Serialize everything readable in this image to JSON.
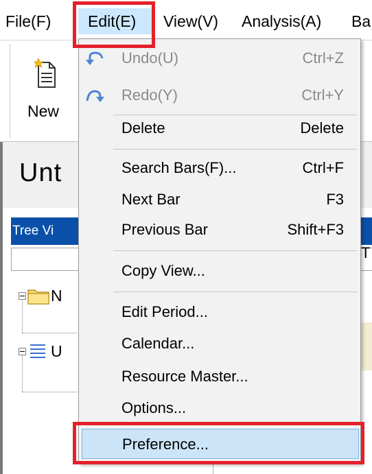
{
  "menubar": {
    "items": [
      {
        "label": "File(F)"
      },
      {
        "label": "Edit(E)"
      },
      {
        "label": "View(V)"
      },
      {
        "label": "Analysis(A)"
      },
      {
        "label": "Ba"
      }
    ]
  },
  "toolbar": {
    "new_label": "New",
    "new_icon": "new-document-icon"
  },
  "document": {
    "title": "Unt"
  },
  "tree": {
    "header": "Tree Vi",
    "nodes": [
      {
        "label": "N",
        "icon": "folder-icon"
      },
      {
        "label": "U",
        "icon": "list-icon"
      }
    ]
  },
  "grid": {
    "peek_label": "T"
  },
  "edit_menu": {
    "items": [
      {
        "label": "Undo(U)",
        "shortcut": "Ctrl+Z",
        "icon": "undo-icon",
        "disabled": true
      },
      {
        "label": "Redo(Y)",
        "shortcut": "Ctrl+Y",
        "icon": "redo-icon",
        "disabled": true
      },
      {
        "label": "Delete",
        "shortcut": "Delete"
      },
      {
        "label": "Search Bars(F)...",
        "shortcut": "Ctrl+F"
      },
      {
        "label": "Next Bar",
        "shortcut": "F3"
      },
      {
        "label": "Previous Bar",
        "shortcut": "Shift+F3"
      },
      {
        "label": "Copy View..."
      },
      {
        "label": "Edit Period..."
      },
      {
        "label": "Calendar..."
      },
      {
        "label": "Resource Master..."
      },
      {
        "label": "Options..."
      },
      {
        "label": "Preference...",
        "hovered": true
      }
    ]
  },
  "colors": {
    "highlight_box": "#e5202a",
    "hover_bg": "#cce4f7",
    "tree_header_bg": "#0a50a8",
    "icon_blue": "#4a86d4"
  }
}
